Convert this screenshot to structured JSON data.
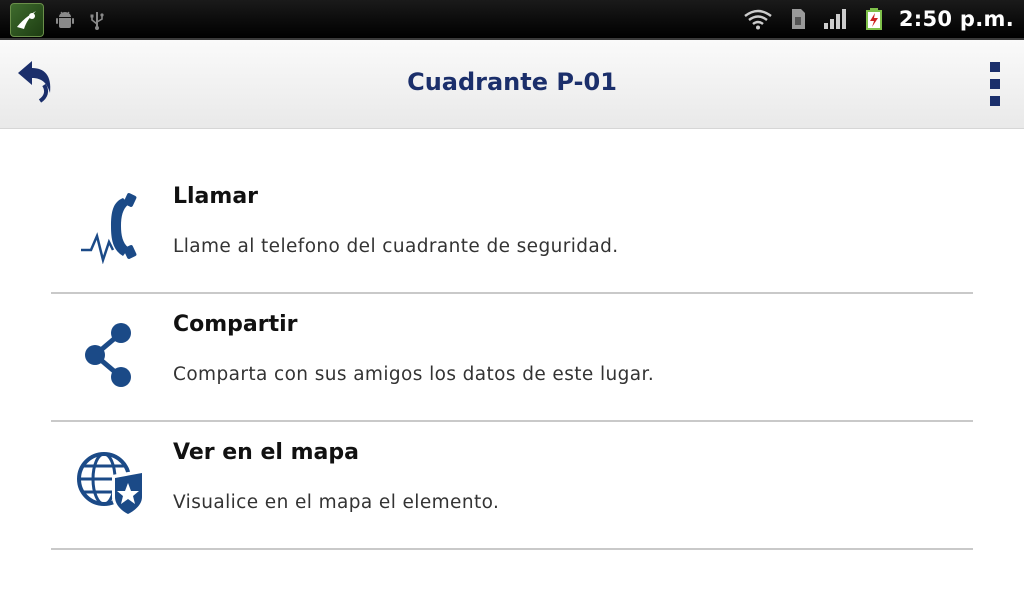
{
  "status_bar": {
    "icons": [
      "app-launcher-icon",
      "android-debug-icon",
      "usb-icon",
      "wifi-icon",
      "sim-card-icon",
      "signal-strength-icon",
      "battery-charging-icon"
    ],
    "time": "2:50 p.m."
  },
  "action_bar": {
    "title": "Cuadrante P-01",
    "back_icon": "back-arrow-icon",
    "menu_icon": "overflow-menu-icon",
    "accent_color": "#1b2f6b"
  },
  "items": [
    {
      "icon": "phone-call-icon",
      "title": "Llamar",
      "description": "Llame al telefono del cuadrante de seguridad."
    },
    {
      "icon": "share-icon",
      "title": "Compartir",
      "description": "Comparta con sus amigos los datos de este lugar."
    },
    {
      "icon": "globe-shield-icon",
      "title": "Ver en el mapa",
      "description": "Visualice en el mapa el elemento."
    }
  ]
}
